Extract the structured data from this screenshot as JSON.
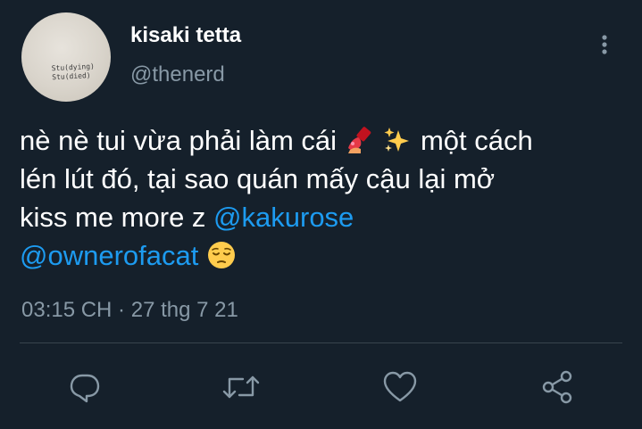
{
  "tweet": {
    "author": {
      "display_name": "kisaki tetta",
      "handle": "@thenerd",
      "avatar_text": "Stu(dying)\nStu(died)"
    },
    "text": {
      "line1_prefix": "nè nè tui vừa phải làm cái",
      "line1_suffix": "một cách",
      "line2": "lén lút đó, tại sao quán mấy cậu lại mở",
      "line3_prefix": "kiss me more z",
      "mention1": "@kakurose",
      "mention2": "@ownerofacat"
    },
    "emojis": [
      "nail-polish-emoji",
      "sparkles-emoji",
      "pensive-face-emoji"
    ],
    "timestamp": "03:15 CH · 27 thg 7 21"
  },
  "actions": [
    {
      "name": "reply-button",
      "icon": "reply-icon"
    },
    {
      "name": "retweet-button",
      "icon": "retweet-icon"
    },
    {
      "name": "like-button",
      "icon": "heart-icon"
    },
    {
      "name": "share-button",
      "icon": "share-icon"
    }
  ],
  "colors": {
    "background": "#15202b",
    "text": "#ffffff",
    "secondary": "#8899a6",
    "link": "#1d9bf0",
    "divider": "#38444d"
  }
}
